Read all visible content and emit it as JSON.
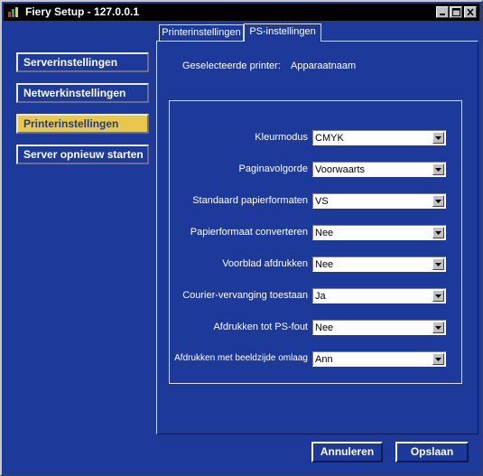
{
  "window": {
    "title": "Fiery Setup - 127.0.0.1"
  },
  "sidebar": {
    "items": [
      {
        "label": "Serverinstellingen"
      },
      {
        "label": "Netwerkinstellingen"
      },
      {
        "label": "Printerinstellingen",
        "active": true
      },
      {
        "label": "Server opnieuw starten"
      }
    ]
  },
  "tabs": [
    {
      "label": "Printerinstellingen"
    },
    {
      "label": "PS-instellingen",
      "selected": true
    }
  ],
  "printer": {
    "label": "Geselecteerde printer:",
    "value": "Apparaatnaam"
  },
  "settings": [
    {
      "label": "Kleurmodus",
      "value": "CMYK"
    },
    {
      "label": "Paginavolgorde",
      "value": "Voorwaarts"
    },
    {
      "label": "Standaard papierformaten",
      "value": "VS"
    },
    {
      "label": "Papierformaat converteren",
      "value": "Nee"
    },
    {
      "label": "Voorblad afdrukken",
      "value": "Nee"
    },
    {
      "label": "Courier-vervanging toestaan",
      "value": "Ja"
    },
    {
      "label": "Afdrukken tot PS-fout",
      "value": "Nee"
    },
    {
      "label": "Afdrukken met beeldzijde omlaag",
      "value": "Ann"
    }
  ],
  "buttons": {
    "cancel": "Annuleren",
    "save": "Opslaan"
  },
  "colors": {
    "background": "#1d3a9a",
    "active_item": "#e8c84a",
    "titlebar": "#000000"
  },
  "icons": [
    "fiery-logo-icon",
    "minimize-icon",
    "maximize-icon",
    "close-icon",
    "dropdown-arrow-icon"
  ]
}
